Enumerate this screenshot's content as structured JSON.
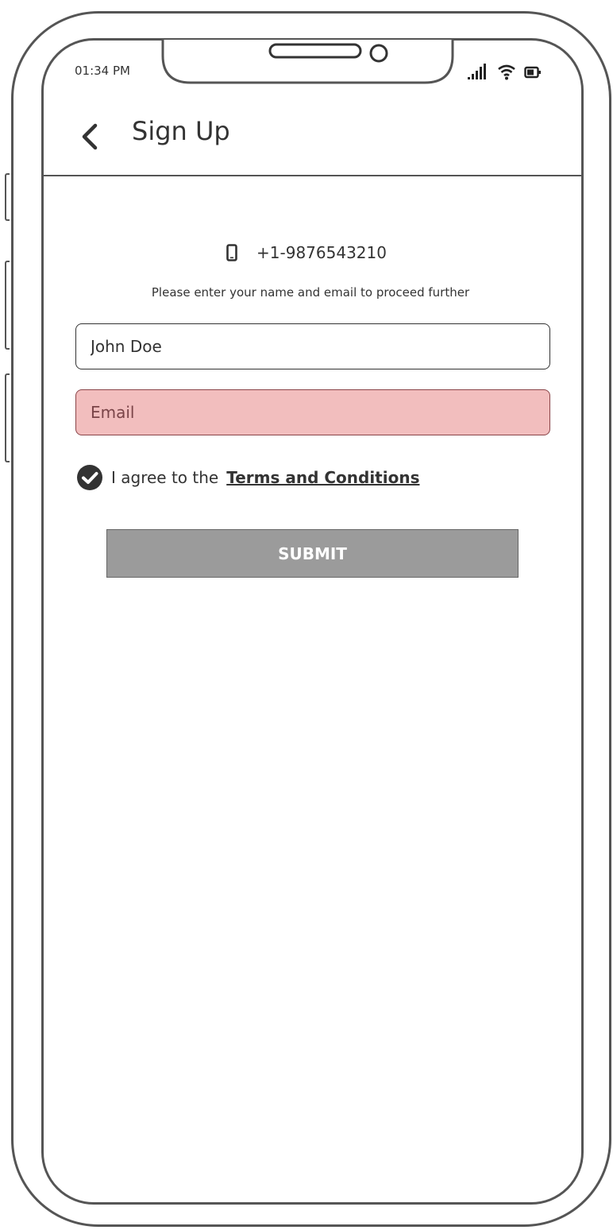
{
  "status_bar": {
    "time": "01:34 PM",
    "icons": [
      "signal-icon",
      "wifi-icon",
      "battery-icon"
    ]
  },
  "header": {
    "back_icon": "chevron-left-icon",
    "title": "Sign Up"
  },
  "form": {
    "phone_icon": "mobile-phone-icon",
    "phone_number": "+1-9876543210",
    "instruction": "Please enter your name and email to proceed further",
    "name_value": "John Doe",
    "email_placeholder": "Email",
    "email_value": "",
    "agree_checked": true,
    "agree_text": "I agree to the",
    "terms_link": "Terms and Conditions",
    "submit_label": "SUBMIT"
  },
  "colors": {
    "frame": "#555555",
    "text": "#333333",
    "email_error_bg": "#f2bebe",
    "email_error_border": "#8a4448",
    "submit_bg": "#9b9b9b"
  }
}
